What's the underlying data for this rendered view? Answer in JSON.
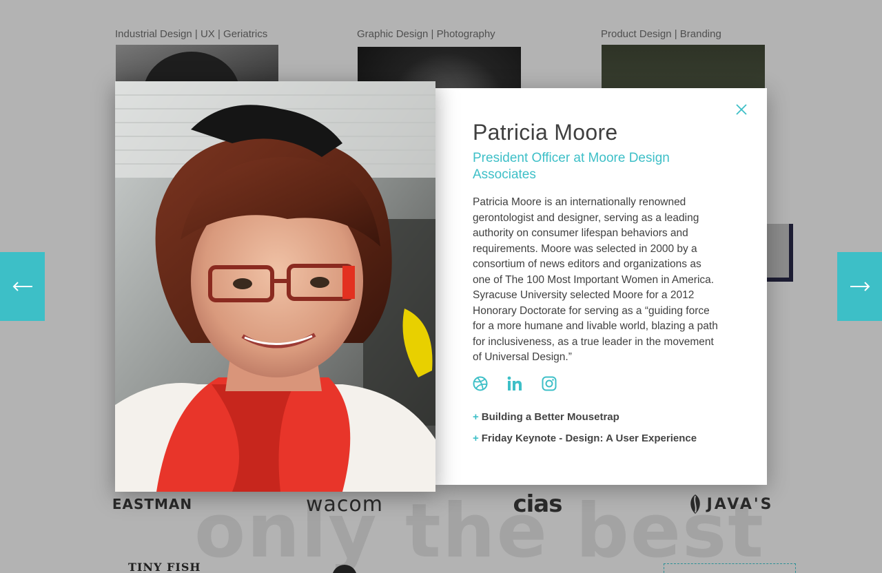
{
  "background": {
    "speaker_tags": [
      "Industrial Design | UX | Geriatrics",
      "Graphic Design | Photography",
      "Product Design | Branding"
    ],
    "watermark": "only the best",
    "sponsors": [
      "EASTMAN",
      "wacom",
      "cias",
      "JAVA'S",
      "TINY FISH"
    ],
    "nav_prev_icon": "arrow-left-icon",
    "nav_next_icon": "arrow-right-icon"
  },
  "modal": {
    "name": "Patricia Moore",
    "role": "President Officer at Moore Design Associates",
    "bio": "Patricia Moore is an internationally renowned gerontologist and designer, serving as a leading authority on consumer lifespan behaviors and requirements. Moore was selected in 2000 by a consortium of news editors and organizations as one of The 100 Most Important Women in America. Syracuse University selected Moore for a 2012 Honorary Doctorate for serving as a “guiding force for a more humane and livable world, blazing a path for inclusiveness, as a true leader in the movement of Universal Design.”",
    "social_icons": [
      "dribbble-icon",
      "linkedin-icon",
      "instagram-icon"
    ],
    "talks": [
      {
        "prefix": "+",
        "title": "Building a Better Mousetrap"
      },
      {
        "prefix": "+",
        "title": "Friday Keynote - Design: A User Experience"
      }
    ],
    "close_icon": "close-icon"
  },
  "colors": {
    "accent": "#3dbfc7",
    "text": "#3f3f3f",
    "overlay": "#b3b3b3"
  }
}
